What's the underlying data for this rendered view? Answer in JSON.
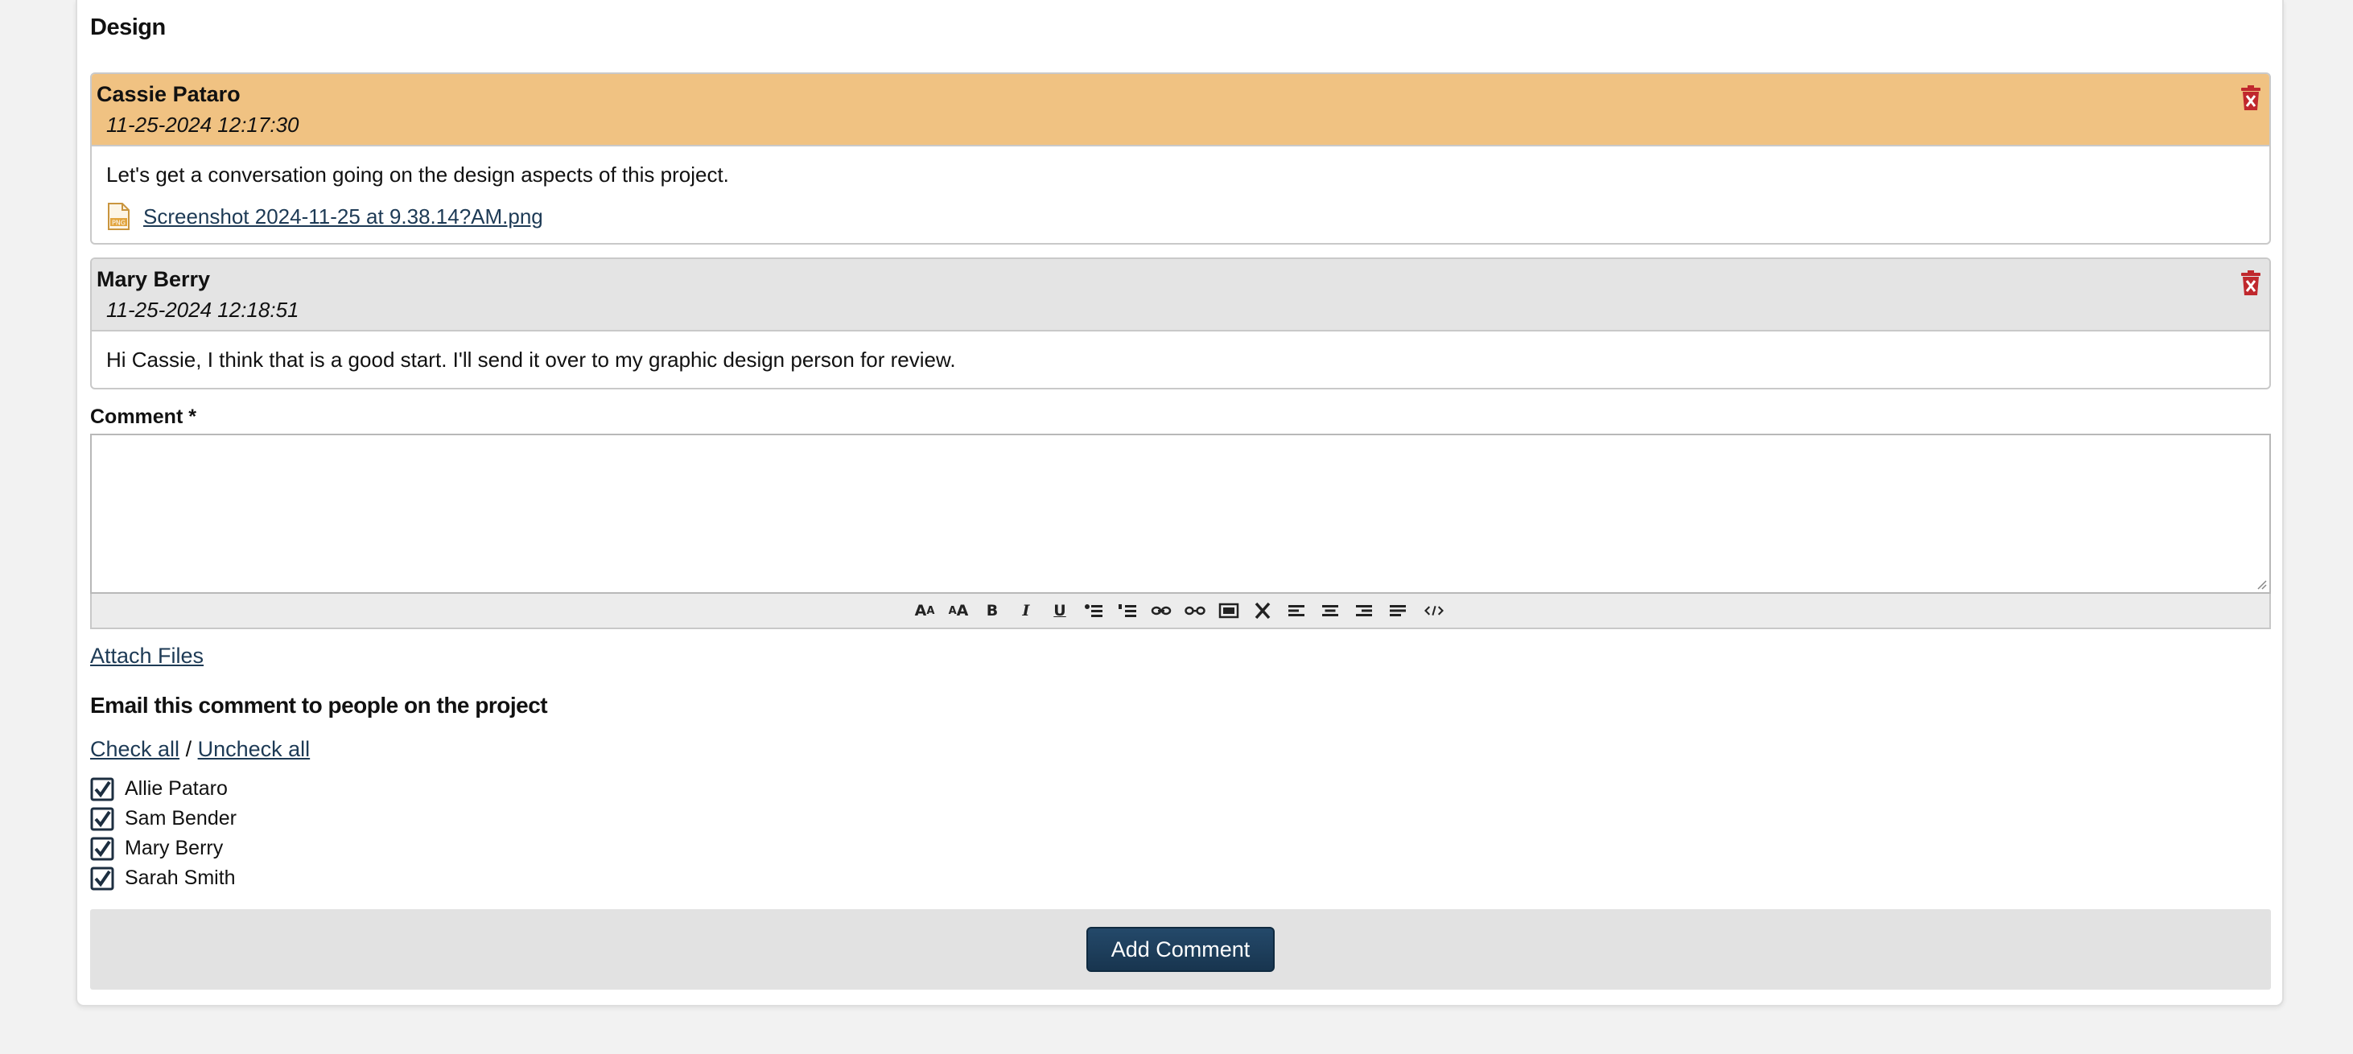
{
  "section": {
    "title": "Design"
  },
  "comments": [
    {
      "author": "Cassie Pataro",
      "date": "11-25-2024 12:17:30",
      "body": "Let's get a conversation going on the design aspects of this project.",
      "attachment": "Screenshot 2024-11-25 at 9.38.14?AM.png",
      "header_color": "#f0c282"
    },
    {
      "author": "Mary Berry",
      "date": "11-25-2024 12:18:51",
      "body": "Hi Cassie, I think that is a good start. I'll send it over to my graphic design person for review.",
      "header_color": "#e4e4e4"
    }
  ],
  "form": {
    "comment_label": "Comment *",
    "comment_value": "",
    "toolbar": [
      "font-size-decrease-icon",
      "font-size-increase-icon",
      "bold-icon",
      "italic-icon",
      "underline-icon",
      "unordered-list-icon",
      "ordered-list-icon",
      "link-icon",
      "unlink-icon",
      "image-icon",
      "remove-format-icon",
      "align-left-icon",
      "align-center-icon",
      "align-right-icon",
      "justify-icon",
      "source-code-icon"
    ],
    "attach_label": "Attach Files",
    "email_title": "Email this comment to people on the project",
    "check_all": "Check all",
    "separator": "/",
    "uncheck_all": "Uncheck all",
    "recipients": [
      {
        "name": "Allie Pataro",
        "checked": true
      },
      {
        "name": "Sam Bender",
        "checked": true
      },
      {
        "name": "Mary Berry",
        "checked": true
      },
      {
        "name": "Sarah Smith",
        "checked": true
      }
    ],
    "submit_label": "Add Comment"
  },
  "colors": {
    "accent": "#1f3f5b",
    "link": "#1d3a55",
    "delete": "#c0282d"
  }
}
